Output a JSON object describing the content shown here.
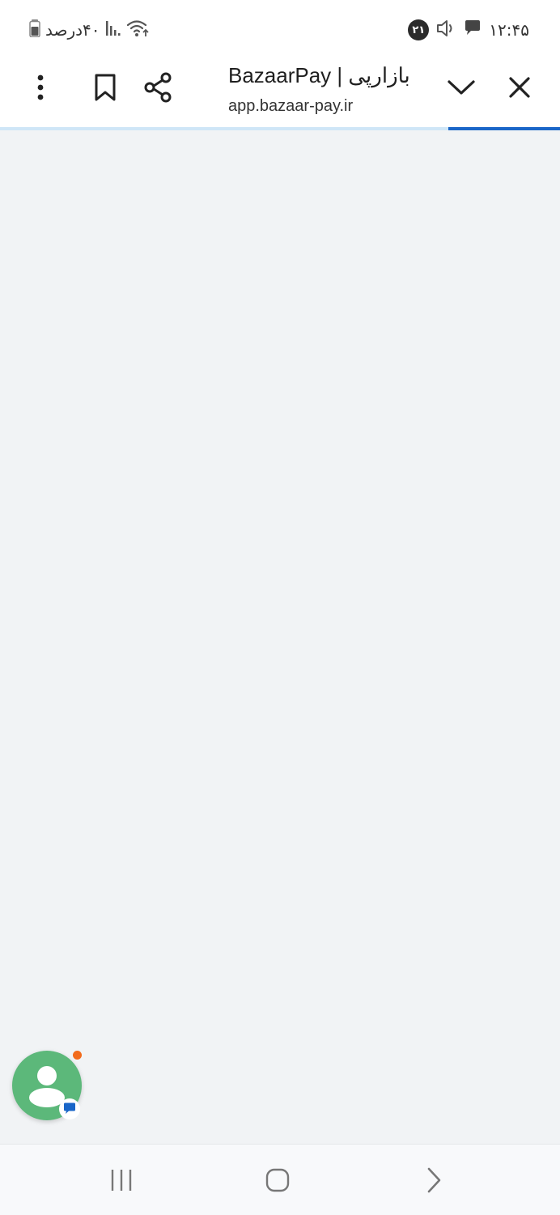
{
  "status_bar": {
    "time": "۱۲:۴۵",
    "notification_count": "۲۱",
    "battery_text": "۴۰درصد",
    "icons": [
      "battery-icon",
      "signal-icon",
      "wifi-icon",
      "notification-badge",
      "volume-icon",
      "message-icon"
    ]
  },
  "toolbar": {
    "title": "BazaarPay | بازارپی",
    "url": "app.bazaar-pay.ir",
    "icons": [
      "more-vert-icon",
      "bookmark-icon",
      "share-icon",
      "chevron-down-icon",
      "close-icon"
    ]
  },
  "progress": {
    "value": 0.2
  },
  "colors": {
    "accent": "#1a66c8",
    "progress_track": "#cfe6f7",
    "fab": "#5cb87a",
    "notification_dot": "#f26a1b",
    "content_bg": "#f1f3f5"
  },
  "chat_fab": {
    "icon": "person-icon",
    "badge_icon": "chat-bubble-icon"
  },
  "nav_bar": {
    "icons": [
      "recents-icon",
      "home-icon",
      "back-icon"
    ]
  }
}
